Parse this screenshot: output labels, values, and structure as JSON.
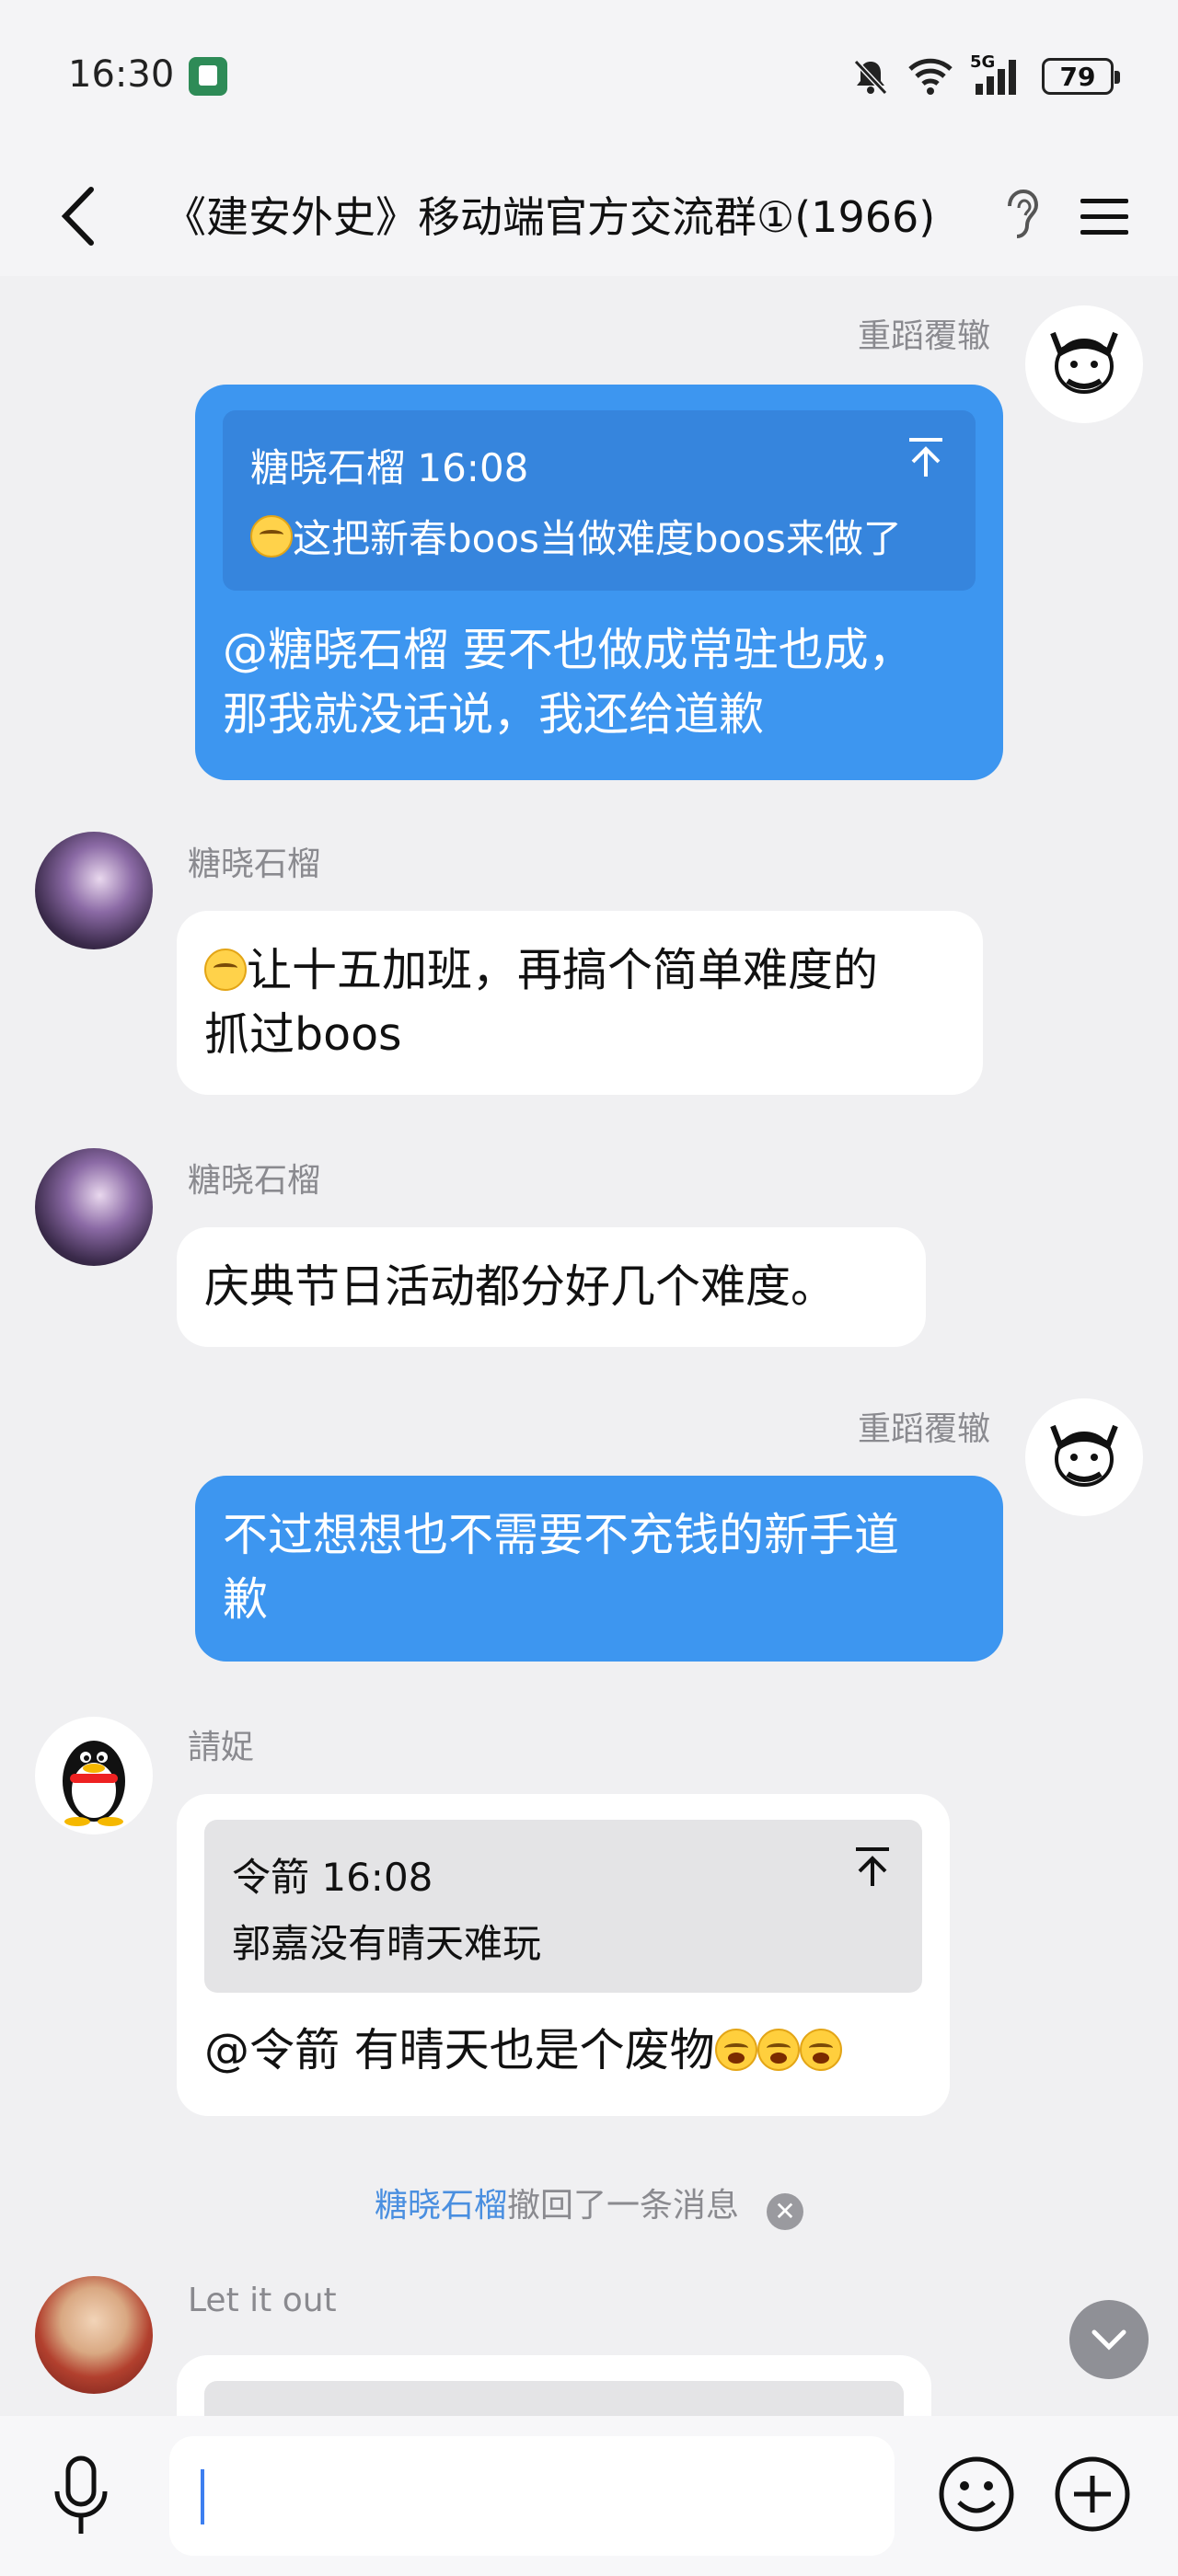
{
  "status": {
    "time": "16:30",
    "network": "5G",
    "battery": "79"
  },
  "header": {
    "title": "《建安外史》移动端官方交流群①(1966)"
  },
  "messages": [
    {
      "sender": "重蹈覆辙",
      "quote": {
        "author_time": "糖晓石榴 16:08",
        "text": "这把新春boos当做难度boos来做了"
      },
      "lines": [
        "@糖晓石榴 要不也做成常驻也成，",
        "那我就没话说，我还给道歉"
      ]
    },
    {
      "sender": "糖晓石榴",
      "lines": [
        "让十五加班，再搞个简单难度的",
        "抓过boos"
      ]
    },
    {
      "sender": "糖晓石榴",
      "lines": [
        "庆典节日活动都分好几个难度。"
      ]
    },
    {
      "sender": "重蹈覆辙",
      "lines": [
        "不过想想也不需要不充钱的新手道",
        "歉"
      ]
    },
    {
      "sender": "請娖",
      "quote": {
        "author_time": "令箭 16:08",
        "text": "郭嘉没有晴天难玩"
      },
      "lines": [
        "@令箭 有晴天也是个废物"
      ]
    },
    {
      "sender": "Let it out"
    }
  ],
  "recall": {
    "who": "糖晓石榴",
    "text": "撤回了一条消息"
  },
  "input": {
    "value": ""
  },
  "colors": {
    "blue_bubble": "#3d96f0",
    "link": "#4a8fe0"
  }
}
